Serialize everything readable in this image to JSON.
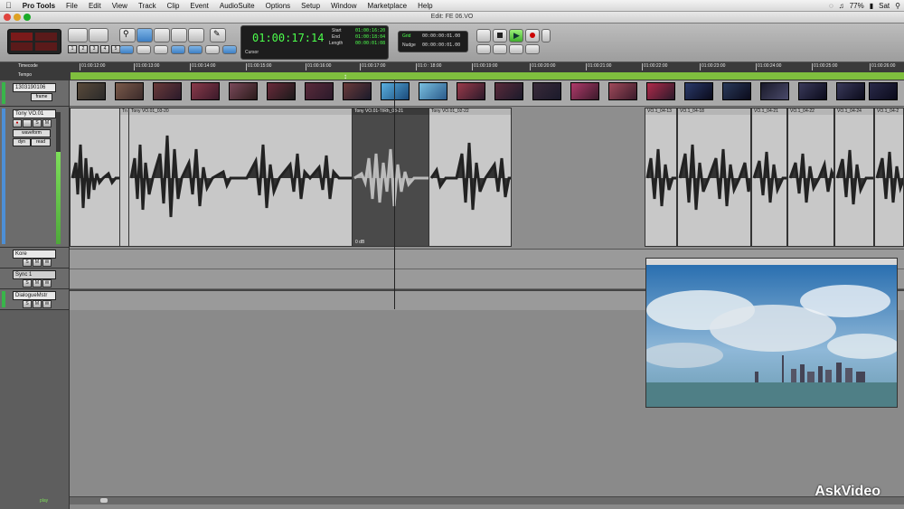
{
  "menubar": {
    "apple": "",
    "app": "Pro Tools",
    "items": [
      "File",
      "Edit",
      "View",
      "Track",
      "Clip",
      "Event",
      "AudioSuite",
      "Options",
      "Setup",
      "Window",
      "Marketplace",
      "Help"
    ],
    "battery": "77%",
    "day": "Sat"
  },
  "window": {
    "title": "Edit: FE 06.VO"
  },
  "toolbar": {
    "main_counter": "01:00:17:14",
    "start_label": "Start",
    "end_label": "End",
    "length_label": "Length",
    "start_value": "01:00:16:20",
    "end_value": "01:00:18:04",
    "length_value": "00:00:01:08",
    "cursor_label": "Cursor",
    "grid_label": "Grid",
    "nudge_label": "Nudge",
    "grid_value": "00:00:00:01.00",
    "nudge_value": "00:00:00:01.00",
    "zoom_presets": [
      "1",
      "2",
      "3",
      "4",
      "5"
    ]
  },
  "rulers": {
    "timecode_label": "Timecode",
    "tempo_label": "Tempo",
    "ticks": [
      "01:00:12:00",
      "01:00:13:00",
      "01:00:14:00",
      "01:00:15:00",
      "01:00:16:00",
      "01:00:17:00",
      "01:0 : 18:00",
      "01:00:19:00",
      "01:00:20:00",
      "01:00:21:00",
      "01:00:22:00",
      "01:00:23:00",
      "01:00:24:00",
      "01:00:25:00",
      "01:00:26:00"
    ]
  },
  "tracks": {
    "video": {
      "name": "1303190106",
      "mode": "frame"
    },
    "audio": {
      "name": "Tony VO.01",
      "view": "waveform",
      "dyn": "dyn",
      "read": "read"
    },
    "kore": {
      "name": "Kore"
    },
    "sync": {
      "name": "Sync 1"
    },
    "dialogue": {
      "name": "DialogueMstr"
    },
    "buttons": {
      "s": "S",
      "m": "M",
      "rec": "●",
      "wave": "W"
    }
  },
  "clips": [
    {
      "name": "Tn"
    },
    {
      "name": "Tony VO.01_03-20"
    },
    {
      "name": "Tony VO.01-TIRh_03-21",
      "gain": "0 dB"
    },
    {
      "name": "Tony VO.01_02-22"
    },
    {
      "name": "VO.1_04-13"
    },
    {
      "name": "VO.1_04-18"
    },
    {
      "name": "VO.1_04-21"
    },
    {
      "name": "VO.1_04-22"
    },
    {
      "name": "VO.1_04-24"
    },
    {
      "name": "VO.1_04-2"
    }
  ],
  "footer": {
    "play_label": "play"
  },
  "brand": {
    "logo": "AskVideo"
  },
  "colors": {
    "counter_green": "#4cff4c",
    "selection": "#4a4a4a",
    "ruler_bg": "#3a3a3a"
  }
}
